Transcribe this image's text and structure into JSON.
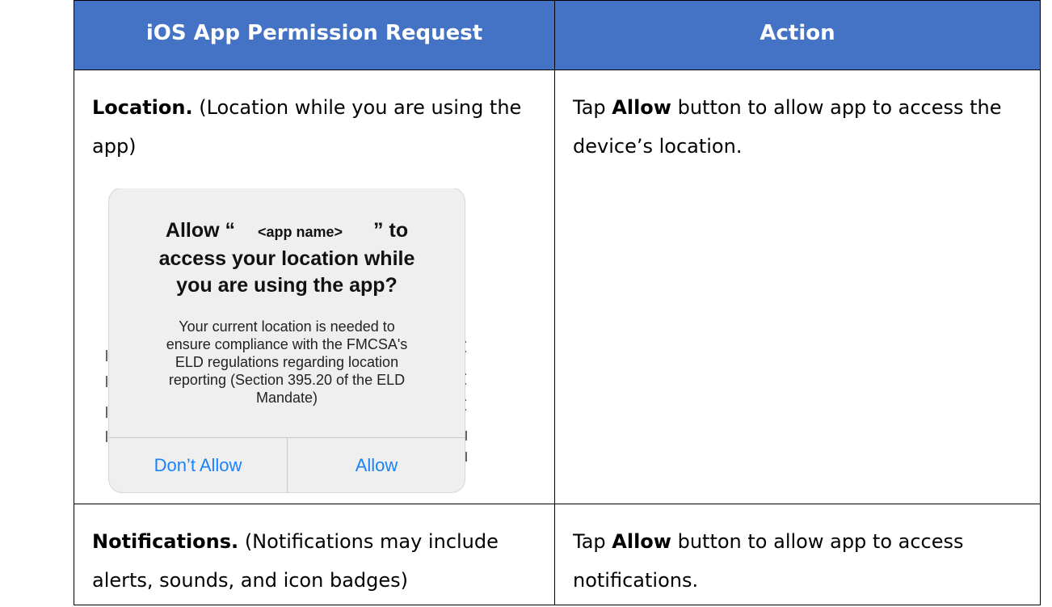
{
  "table": {
    "headers": [
      "iOS App Permission Request",
      "Action"
    ],
    "rows": [
      {
        "request_title": "Location.",
        "request_detail": "(Location while you are using the app)",
        "action_prefix": "Tap",
        "action_bold": "Allow",
        "action_suffix": "button to allow app to access the device’s location."
      },
      {
        "request_title": "Notifications.",
        "request_detail": "(Notifications may include alerts, sounds, and icon badges)",
        "action_prefix": "Tap",
        "action_bold": "Allow",
        "action_suffix": "button to allow app to access notifications."
      }
    ]
  },
  "alert": {
    "title_prefix": "Allow “",
    "app_name": "<app name>",
    "title_suffix": "” to",
    "title_line2": "access your location while",
    "title_line3": "you are using the app?",
    "message_lines": [
      "Your current location is needed to",
      "ensure compliance with the FMCSA's",
      "ELD regulations regarding location",
      "reporting (Section 395.20 of the ELD",
      "Mandate)"
    ],
    "dont_allow_label": "Don’t Allow",
    "allow_label": "Allow",
    "button_color": "#1a82fb"
  },
  "colors": {
    "header_bg": "#4472c4",
    "header_text": "#ffffff"
  }
}
